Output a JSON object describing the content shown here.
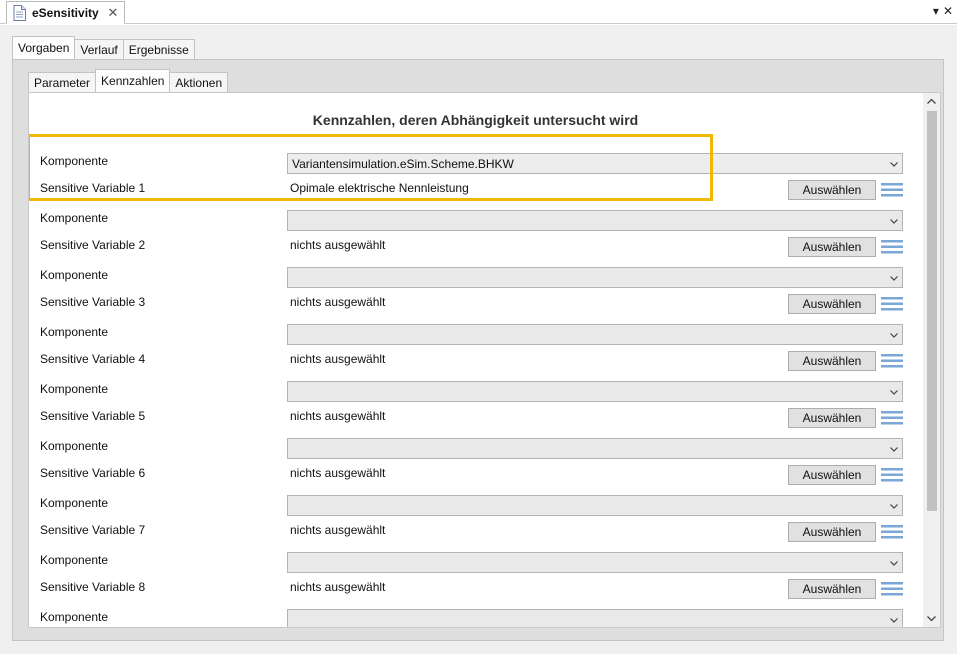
{
  "editor": {
    "tab_title": "eSensitivity",
    "close_glyph": "✕",
    "menu_glyph": "▾",
    "window_close_glyph": "✕"
  },
  "tabs_top": [
    {
      "label": "Vorgaben",
      "active": true
    },
    {
      "label": "Verlauf",
      "active": false
    },
    {
      "label": "Ergebnisse",
      "active": false
    }
  ],
  "tabs_inner": [
    {
      "label": "Parameter",
      "active": false
    },
    {
      "label": "Kennzahlen",
      "active": true
    },
    {
      "label": "Aktionen",
      "active": false
    }
  ],
  "section_title": "Kennzahlen, deren Abhängigkeit untersucht wird",
  "rows": [
    {
      "komponente_label": "Komponente",
      "komponente_value": "Variantensimulation.eSim.Scheme.BHKW",
      "variable_label": "Sensitive Variable 1",
      "variable_value": "Opimale elektrische Nennleistung",
      "button": "Auswählen"
    },
    {
      "komponente_label": "Komponente",
      "komponente_value": "",
      "variable_label": "Sensitive Variable 2",
      "variable_value": "nichts ausgewählt",
      "button": "Auswählen"
    },
    {
      "komponente_label": "Komponente",
      "komponente_value": "",
      "variable_label": "Sensitive Variable 3",
      "variable_value": "nichts ausgewählt",
      "button": "Auswählen"
    },
    {
      "komponente_label": "Komponente",
      "komponente_value": "",
      "variable_label": "Sensitive Variable 4",
      "variable_value": "nichts ausgewählt",
      "button": "Auswählen"
    },
    {
      "komponente_label": "Komponente",
      "komponente_value": "",
      "variable_label": "Sensitive Variable 5",
      "variable_value": "nichts ausgewählt",
      "button": "Auswählen"
    },
    {
      "komponente_label": "Komponente",
      "komponente_value": "",
      "variable_label": "Sensitive Variable 6",
      "variable_value": "nichts ausgewählt",
      "button": "Auswählen"
    },
    {
      "komponente_label": "Komponente",
      "komponente_value": "",
      "variable_label": "Sensitive Variable 7",
      "variable_value": "nichts ausgewählt",
      "button": "Auswählen"
    },
    {
      "komponente_label": "Komponente",
      "komponente_value": "",
      "variable_label": "Sensitive Variable 8",
      "variable_value": "nichts ausgewählt",
      "button": "Auswählen"
    }
  ],
  "last_row": {
    "komponente_label": "Komponente",
    "komponente_value": ""
  },
  "colors": {
    "highlight": "#f0b800",
    "panel_bg": "#dedede",
    "list_icon": "#7aa7d6"
  },
  "icons": {
    "editor_tab": "document-icon",
    "dropdown": "chevron-down-icon",
    "row_list": "list-icon"
  }
}
